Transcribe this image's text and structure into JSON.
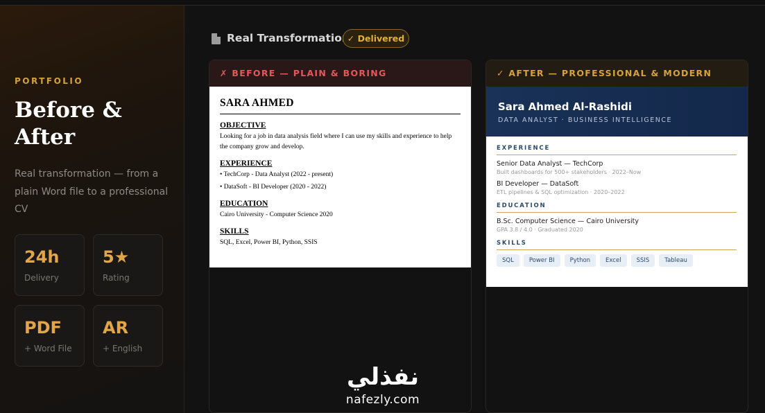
{
  "sidebar": {
    "eyebrow": "PORTFOLIO",
    "title": "Before & After",
    "description": "Real transformation — from a plain Word file to a professional CV",
    "stats": [
      {
        "value": "24h",
        "label": "Delivery"
      },
      {
        "value": "5★",
        "label": "Rating"
      },
      {
        "value": "PDF",
        "label": "+ Word File"
      },
      {
        "value": "AR",
        "label": "+ English"
      }
    ]
  },
  "header": {
    "icon": "document-icon",
    "title": "Real Transformation",
    "badge": "✓ Delivered"
  },
  "before": {
    "label": "✗ BEFORE — PLAIN & BORING",
    "name": "SARA AHMED",
    "objective_heading": "OBJECTIVE",
    "objective_text": "Looking for a job in data analysis field where I can use my skills and experience to help the company grow and develop.",
    "experience_heading": "EXPERIENCE",
    "experience_items": [
      "• TechCorp - Data Analyst (2022 - present)",
      "• DataSoft - BI Developer (2020 - 2022)"
    ],
    "education_heading": "EDUCATION",
    "education_text": "Cairo University - Computer Science 2020",
    "skills_heading": "SKILLS",
    "skills_text": "SQL, Excel, Power BI, Python, SSIS"
  },
  "after": {
    "label": "✓ AFTER — PROFESSIONAL & MODERN",
    "name": "Sara Ahmed Al-Rashidi",
    "role": "DATA ANALYST · BUSINESS INTELLIGENCE",
    "experience_heading": "EXPERIENCE",
    "jobs": [
      {
        "title": "Senior Data Analyst — TechCorp",
        "sub": "Built dashboards for 500+ stakeholders · 2022–Now"
      },
      {
        "title": "BI Developer — DataSoft",
        "sub": "ETL pipelines & SQL optimization · 2020–2022"
      }
    ],
    "education_heading": "EDUCATION",
    "education_title": "B.Sc. Computer Science — Cairo University",
    "education_sub": "GPA 3.8 / 4.0 · Graduated 2020",
    "skills_heading": "SKILLS",
    "skills": [
      "SQL",
      "Power BI",
      "Python",
      "Excel",
      "SSIS",
      "Tableau"
    ]
  },
  "watermark": {
    "arabic": "نفذلي",
    "latin": "nafezly.com"
  }
}
